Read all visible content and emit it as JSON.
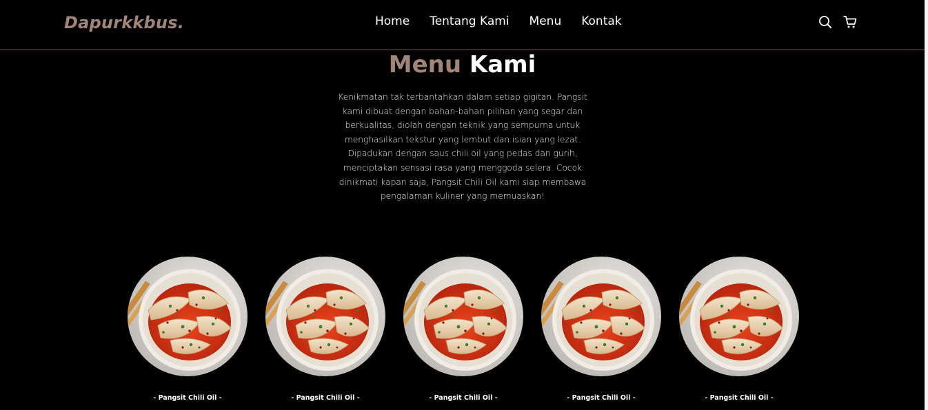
{
  "brand": {
    "name": "Dapurkkbus.",
    "color": "#a18677"
  },
  "nav": {
    "items": [
      {
        "label": "Home"
      },
      {
        "label": "Tentang Kami"
      },
      {
        "label": "Menu"
      },
      {
        "label": "Kontak"
      }
    ],
    "icons": [
      "search-icon",
      "cart-icon"
    ]
  },
  "section": {
    "title_accent": "Menu",
    "title_main": "Kami",
    "description": "Kenikmatan tak terbantahkan dalam setiap gigitan. Pangsit kami dibuat dengan bahan-bahan pilihan yang segar dan berkualitas, diolah dengan teknik yang sempurna untuk menghasilkan tekstur yang lembut dan isian yang lezat. Dipadukan dengan saus chili oil yang pedas dan gurih, menciptakan sensasi rasa yang menggoda selera. Cocok dinikmati kapan saja, Pangsit Chili Oil kami siap membawa pengalaman kuliner yang memuaskan!"
  },
  "menu_items": [
    {
      "name": "- Pangsit Chili Oil -"
    },
    {
      "name": "- Pangsit Chili Oil -"
    },
    {
      "name": "- Pangsit Chili Oil -"
    },
    {
      "name": "- Pangsit Chili Oil -"
    },
    {
      "name": "- Pangsit Chili Oil -"
    }
  ],
  "colors": {
    "accent": "#a18677",
    "background": "#000000",
    "divider": "#7b5a4a"
  }
}
